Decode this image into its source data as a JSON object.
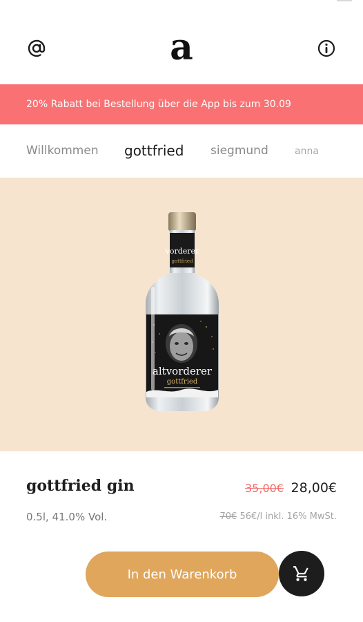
{
  "header": {
    "left_icon": "at-sign-icon",
    "logo_text": "a",
    "right_icon": "info-icon"
  },
  "banner": {
    "text": "20% Rabatt bei Bestellung über die App bis zum 30.09",
    "color": "#f97173"
  },
  "tabs": [
    {
      "label": "Willkommen",
      "active": false
    },
    {
      "label": "gottfried",
      "active": true
    },
    {
      "label": "siegmund",
      "active": false
    },
    {
      "label": "anna",
      "active": false
    }
  ],
  "hero": {
    "background": "#f6e4ce",
    "bottle_label": {
      "brand": "altvorderer",
      "name": "gottfried"
    }
  },
  "product": {
    "title": "gottfried gin",
    "old_price": "35,00€",
    "new_price": "28,00€",
    "volume": "0.5l, 41.0% Vol.",
    "unit_price_old": "70€",
    "unit_price_new": "56€/l inkl. 16% MwSt."
  },
  "actions": {
    "add_to_cart_label": "In den Warenkorb",
    "cart_icon": "shopping-cart-icon",
    "accent": "#dfa65c"
  }
}
